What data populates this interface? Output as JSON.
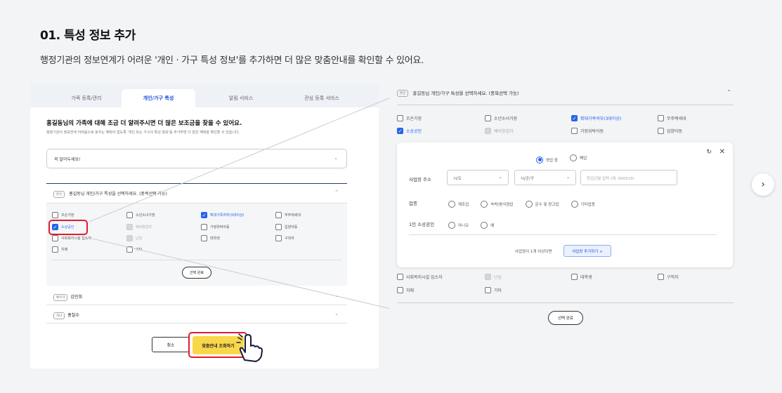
{
  "section": {
    "title": "01. 특성 정보 추가",
    "description": "행정기관의 정보연계가 어려운 '개인 · 가구 특성 정보'를 추가하면 더 많은 맞춤안내를 확인할 수 있어요."
  },
  "left": {
    "tabs": [
      "가족 등록/관리",
      "개인/가구 특성",
      "알림 서비스",
      "관심 등록 서비스"
    ],
    "heading": "홍길동님의 가족에 대해 조금 더 알려주시면 더 많은 보조금을 찾을 수 있어요.",
    "subheading": "행정기관의 정보연계 어려움으로 놓치는 혜택이 없도록 '개인 또는 가구의 특성 정보'를 추가하면 더 많은 혜택을 확인할 수 있습니다.",
    "notice": "꼭 알아두세요!",
    "block_badge": "본인",
    "block_title": "홍길동님 개인/가구 특성을 선택하세요. (중복선택 가능)",
    "options": [
      {
        "label": "조손가정",
        "state": "off"
      },
      {
        "label": "소년소녀가장",
        "state": "off"
      },
      {
        "label": "확대가족여부(3대이상)",
        "state": "on"
      },
      {
        "label": "무주택세대",
        "state": "off"
      },
      {
        "label": "소상공인",
        "state": "on"
      },
      {
        "label": "예비창업자",
        "state": "disabled"
      },
      {
        "label": "가정위탁아동",
        "state": "off"
      },
      {
        "label": "입양아동",
        "state": "off"
      },
      {
        "label": "사회복지시설 입소자",
        "state": "off"
      },
      {
        "label": "난임",
        "state": "disabled"
      },
      {
        "label": "대학생",
        "state": "off"
      },
      {
        "label": "구직자",
        "state": "off"
      },
      {
        "label": "치매",
        "state": "off"
      },
      {
        "label": "기타",
        "state": "off"
      }
    ],
    "done_label": "선택 완료",
    "members": [
      {
        "badge": "배우자",
        "name": "김민희"
      },
      {
        "badge": "자녀",
        "name": "홍철수"
      }
    ],
    "cancel_label": "취소",
    "search_label": "맞춤안내 조회하기"
  },
  "right": {
    "badge": "본인",
    "title": "홍길동님 개인/가구 특성을 선택하세요. (중복선택 가능)",
    "options_top": [
      {
        "label": "조손가정",
        "state": "off"
      },
      {
        "label": "소년소녀가장",
        "state": "off"
      },
      {
        "label": "확대가족여부(3대이상)",
        "state": "on"
      },
      {
        "label": "무주택세대",
        "state": "off"
      },
      {
        "label": "소상공인",
        "state": "on"
      },
      {
        "label": "예비창업자",
        "state": "disabled"
      },
      {
        "label": "가정위탁아동",
        "state": "off"
      },
      {
        "label": "입양아동",
        "state": "off"
      }
    ],
    "status_options": [
      "영업 중",
      "폐업"
    ],
    "address_label": "사업장 주소",
    "sido_placeholder": "시/도",
    "sigungu_placeholder": "시/군/구",
    "date_placeholder": "창업년월 입력 (예: 990529)",
    "industry_label": "업종",
    "industry_options": [
      "제조업",
      "숙박/음식점업",
      "운수 및 창고업",
      "기타업종"
    ],
    "solo_label": "1인 소상공인",
    "solo_options": [
      "아니오",
      "예"
    ],
    "multi_text": "사업장이 1개 이상이면",
    "add_button": "사업장 추가하기 +",
    "options_bottom": [
      {
        "label": "사회복지시설 입소자",
        "state": "off"
      },
      {
        "label": "난임",
        "state": "disabled"
      },
      {
        "label": "대학생",
        "state": "off"
      },
      {
        "label": "구직자",
        "state": "off"
      },
      {
        "label": "치매",
        "state": "off"
      },
      {
        "label": "기타",
        "state": "off"
      }
    ],
    "done_label": "선택 완료"
  },
  "colors": {
    "accent": "#2563eb",
    "highlight": "#e11d2a",
    "search_button": "#f9d74b",
    "navy_rule": "#2b3f6b"
  },
  "icons": [
    "chevron-down-icon",
    "chevron-up-icon",
    "check-icon",
    "refresh-icon",
    "close-icon",
    "hand-pointer-icon",
    "chevron-right-icon"
  ]
}
